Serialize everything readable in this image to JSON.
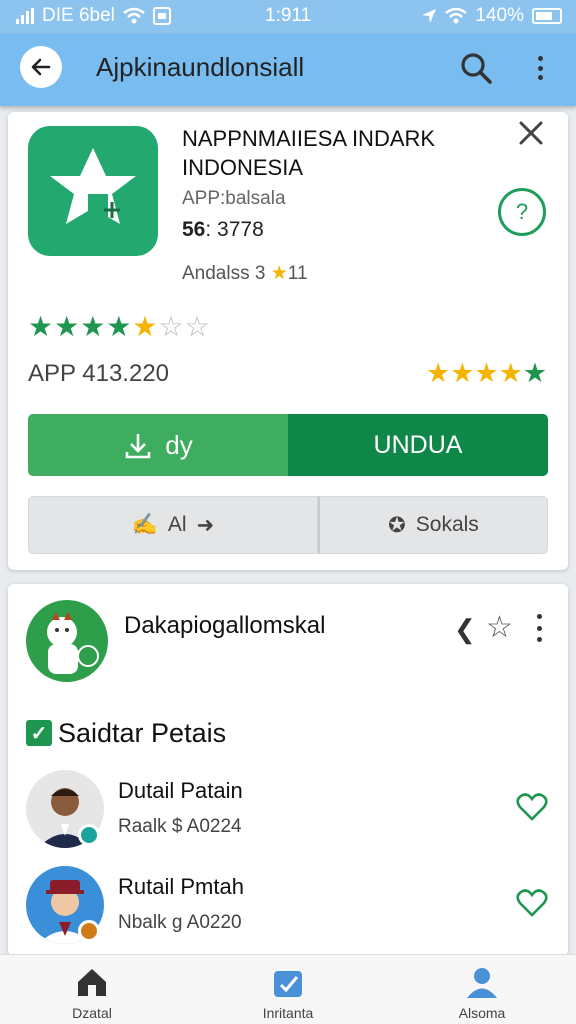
{
  "status_bar": {
    "left_text": "DIE 6bel",
    "time": "1:911",
    "battery": "140%"
  },
  "app_bar": {
    "title": "Ajpkinaundlonsiall",
    "icons": [
      "back-arrow-icon",
      "search-icon",
      "more-vert-icon"
    ]
  },
  "app_card": {
    "name": "NAPPNMAIIESA INDARK INDONESIA",
    "meta_line1": "APP:balsala",
    "meta_line2_prefix": "56",
    "meta_line2_value": ": 3778",
    "meta_line3": "Andalss 3",
    "meta_line3_suffix": "11",
    "rating_stars": 4.5,
    "version_label": "APP",
    "version_value": "413.220",
    "right_rating_stars": 4.5,
    "download_button": "dy",
    "unduh_button": "UNDUA",
    "secondary_left": "Al",
    "secondary_right": "Sokals",
    "colors": {
      "green_light": "#3ead5f",
      "green_dark": "#0f8748",
      "accent": "#1e9650",
      "star": "#f4b400"
    }
  },
  "developer_card": {
    "name": "Dakapiogallomskal",
    "section_title": "Saidtar Petais",
    "people": [
      {
        "name": "Dutail Patain",
        "sub": "Raalk $ A0224"
      },
      {
        "name": "Rutail Pmtah",
        "sub": "Nbalk g A0220"
      }
    ]
  },
  "bottom_nav": {
    "items": [
      {
        "label": "Dzatal",
        "icon": "home-icon"
      },
      {
        "label": "Inritanta",
        "icon": "updates-icon"
      },
      {
        "label": "Alsoma",
        "icon": "profile-icon"
      }
    ]
  }
}
